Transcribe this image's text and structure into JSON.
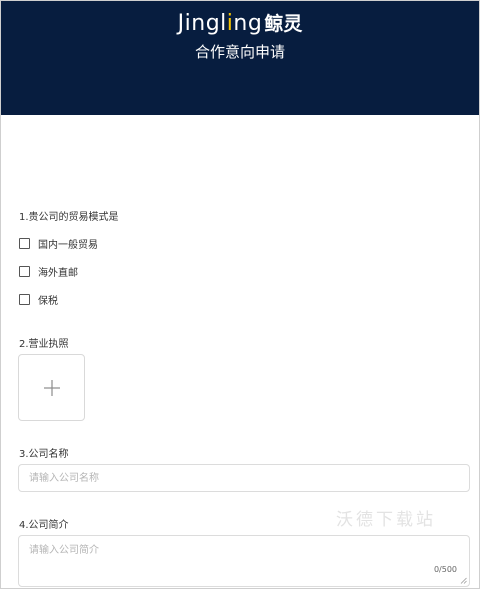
{
  "header": {
    "brand_latin_prefix": "Jingl",
    "brand_latin_dot": "i",
    "brand_latin_suffix": "ng",
    "brand_cn": "鲸灵",
    "subtitle": "合作意向申请",
    "background_color": "#071d3f",
    "accent_color": "#f5c400"
  },
  "questions": {
    "q1": {
      "label": "1.贵公司的贸易模式是",
      "options": [
        {
          "label": "国内一般贸易",
          "checked": false
        },
        {
          "label": "海外直邮",
          "checked": false
        },
        {
          "label": "保税",
          "checked": false
        }
      ]
    },
    "q2": {
      "label": "2.营业执照",
      "upload_icon": "plus-icon"
    },
    "q3": {
      "label": "3.公司名称",
      "placeholder": "请输入公司名称",
      "value": ""
    },
    "q4": {
      "label": "4.公司简介",
      "placeholder": "请输入公司简介",
      "value": "",
      "counter": "0/500"
    }
  },
  "watermark": "沃德下载站"
}
